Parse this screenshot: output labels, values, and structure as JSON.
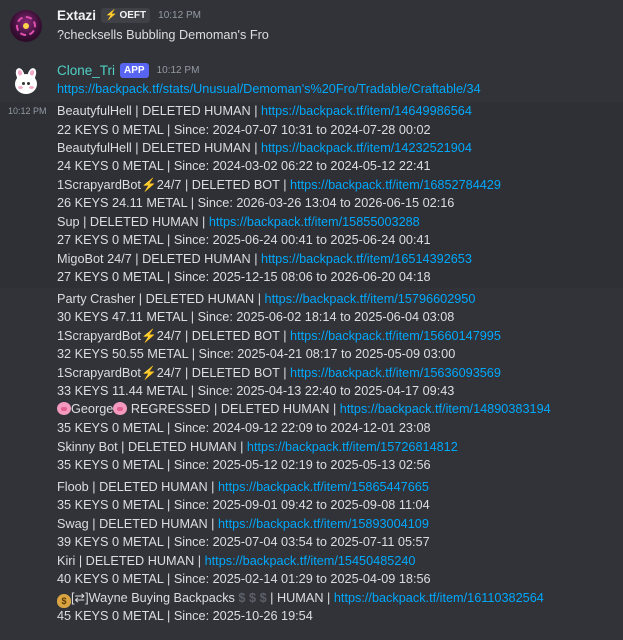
{
  "messages": [
    {
      "author": "Extazi",
      "tag": "OEFT",
      "time": "10:12 PM",
      "text": "?checksells Bubbling Demoman's Fro"
    },
    {
      "author": "Clone_Tri",
      "badge": "APP",
      "time": "10:12 PM",
      "link": "https://backpack.tf/stats/Unusual/Demoman's%20Fro/Tradable/Craftable/34",
      "side_time": "10:12 PM"
    }
  ],
  "sells": [
    {
      "name": "BeautyfulHell | DELETED HUMAN | ",
      "url": "https://backpack.tf/item/14649986564",
      "detail": "22 KEYS 0 METAL | Since: 2024-07-07 10:31 to 2024-07-28 00:02"
    },
    {
      "name": "BeautyfulHell | DELETED HUMAN | ",
      "url": "https://backpack.tf/item/14232521904",
      "detail": "24 KEYS 0 METAL | Since: 2024-03-02 06:22 to 2024-05-12 22:41"
    },
    {
      "name_pre": "1ScrapyardBot",
      "name_post": "24/7 | DELETED BOT | ",
      "url": "https://backpack.tf/item/16852784429",
      "detail": "26 KEYS 24.11 METAL | Since: 2026-03-26 13:04 to 2026-06-15 02:16"
    },
    {
      "name": "Sup | DELETED HUMAN | ",
      "url": "https://backpack.tf/item/15855003288",
      "detail": "27 KEYS 0 METAL | Since: 2025-06-24 00:41 to 2025-06-24 00:41"
    },
    {
      "name": "MigoBot 24/7 | DELETED HUMAN | ",
      "url": "https://backpack.tf/item/16514392653",
      "detail": "27 KEYS 0 METAL | Since: 2025-12-15 08:06 to 2026-06-20 04:18"
    },
    {
      "name": "Party Crasher | DELETED HUMAN | ",
      "url": "https://backpack.tf/item/15796602950",
      "detail": "30 KEYS 47.11 METAL | Since: 2025-06-02 18:14 to 2025-06-04 03:08"
    },
    {
      "name_pre": "1ScrapyardBot",
      "name_post": "24/7 | DELETED BOT | ",
      "url": "https://backpack.tf/item/15660147995",
      "detail": "32 KEYS 50.55 METAL | Since: 2025-04-21 08:17 to 2025-05-09 03:00"
    },
    {
      "name_pre": "1ScrapyardBot",
      "name_post": "24/7 | DELETED BOT | ",
      "url": "https://backpack.tf/item/15636093569",
      "detail": "33 KEYS 11.44 METAL | Since: 2025-04-13 22:40 to 2025-04-17 09:43"
    },
    {
      "name_mid": "George",
      "name_post": "REGRESSED | DELETED HUMAN | ",
      "url": "https://backpack.tf/item/14890383194",
      "detail": "35 KEYS 0 METAL | Since: 2024-09-12 22:09 to 2024-12-01 23:08"
    },
    {
      "name": "Skinny Bot | DELETED HUMAN | ",
      "url": "https://backpack.tf/item/15726814812",
      "detail": "35 KEYS 0 METAL | Since: 2025-05-12 02:19 to 2025-05-13 02:56"
    },
    {
      "name": "Floob | DELETED HUMAN | ",
      "url": "https://backpack.tf/item/15865447665",
      "detail": "35 KEYS 0 METAL | Since: 2025-09-01 09:42 to 2025-09-08 11:04"
    },
    {
      "name": "Swag | DELETED HUMAN | ",
      "url": "https://backpack.tf/item/15893004109",
      "detail": "39 KEYS 0 METAL | Since: 2025-07-04 03:54 to 2025-07-11 05:57"
    },
    {
      "name": "Kiri | DELETED HUMAN | ",
      "url": "https://backpack.tf/item/15450485240",
      "detail": "40 KEYS 0 METAL | Since: 2025-02-14 01:29 to 2025-04-09 18:56"
    },
    {
      "name_mid": "[⇄]Wayne Buying Backpacks ",
      "dollars": "$ $ $",
      "name_post": " | HUMAN | ",
      "url": "https://backpack.tf/item/16110382564",
      "detail": "45 KEYS 0 METAL | Since: 2025-10-26 19:54"
    }
  ]
}
